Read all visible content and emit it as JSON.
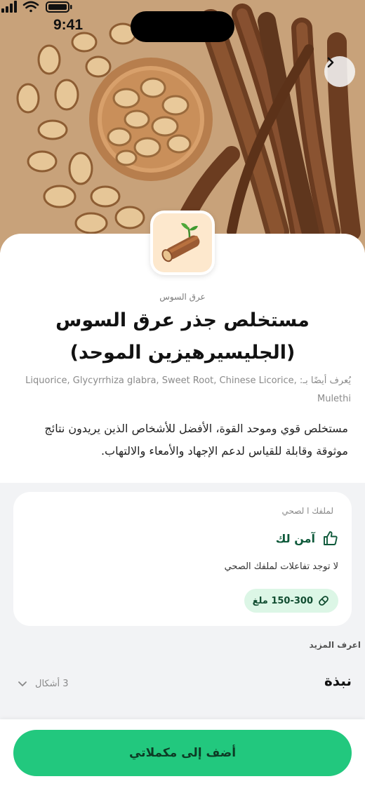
{
  "status_bar": {
    "time": "9:41"
  },
  "supplement": {
    "category": "عرق السوس",
    "title_line1": "مستخلص جذر عرق السوس",
    "title_line2": "(الجليسيرهيزين الموحد)",
    "also_known_as": "يُعرف أيضًا بـ: Liquorice, Glycyrrhiza glabra, Sweet Root, Chinese Licorice, Mulethi",
    "description": "مستخلص قوي وموحد القوة، الأفضل للأشخاص الذين يريدون نتائج موثوقة وقابلة للقياس لدعم الإجهاد والأمعاء والالتهاب."
  },
  "health_card": {
    "profile_label": "لملفك  ا لصحي",
    "safety_label": "آمن لك",
    "interactions_text": "لا توجد تفاعلات لملفك الصحي",
    "dose_label": "150-300 ملغ"
  },
  "learn_more": {
    "heading": "اعرف المزيد",
    "section_title": "نبذة",
    "section_count": "3 أشكال"
  },
  "cta": {
    "label": "أضف إلى مكملاتي"
  },
  "icons": {
    "next": "chevron-right-icon",
    "safety": "thumbs-up-icon",
    "dose": "pill-icon",
    "expand": "chevron-down-icon",
    "product": "licorice-root-icon"
  },
  "colors": {
    "accent": "#22c87e",
    "safe_text": "#0f5a3b",
    "dose_bg": "#dcf6e6",
    "thumb_bg": "#fde8cd"
  }
}
